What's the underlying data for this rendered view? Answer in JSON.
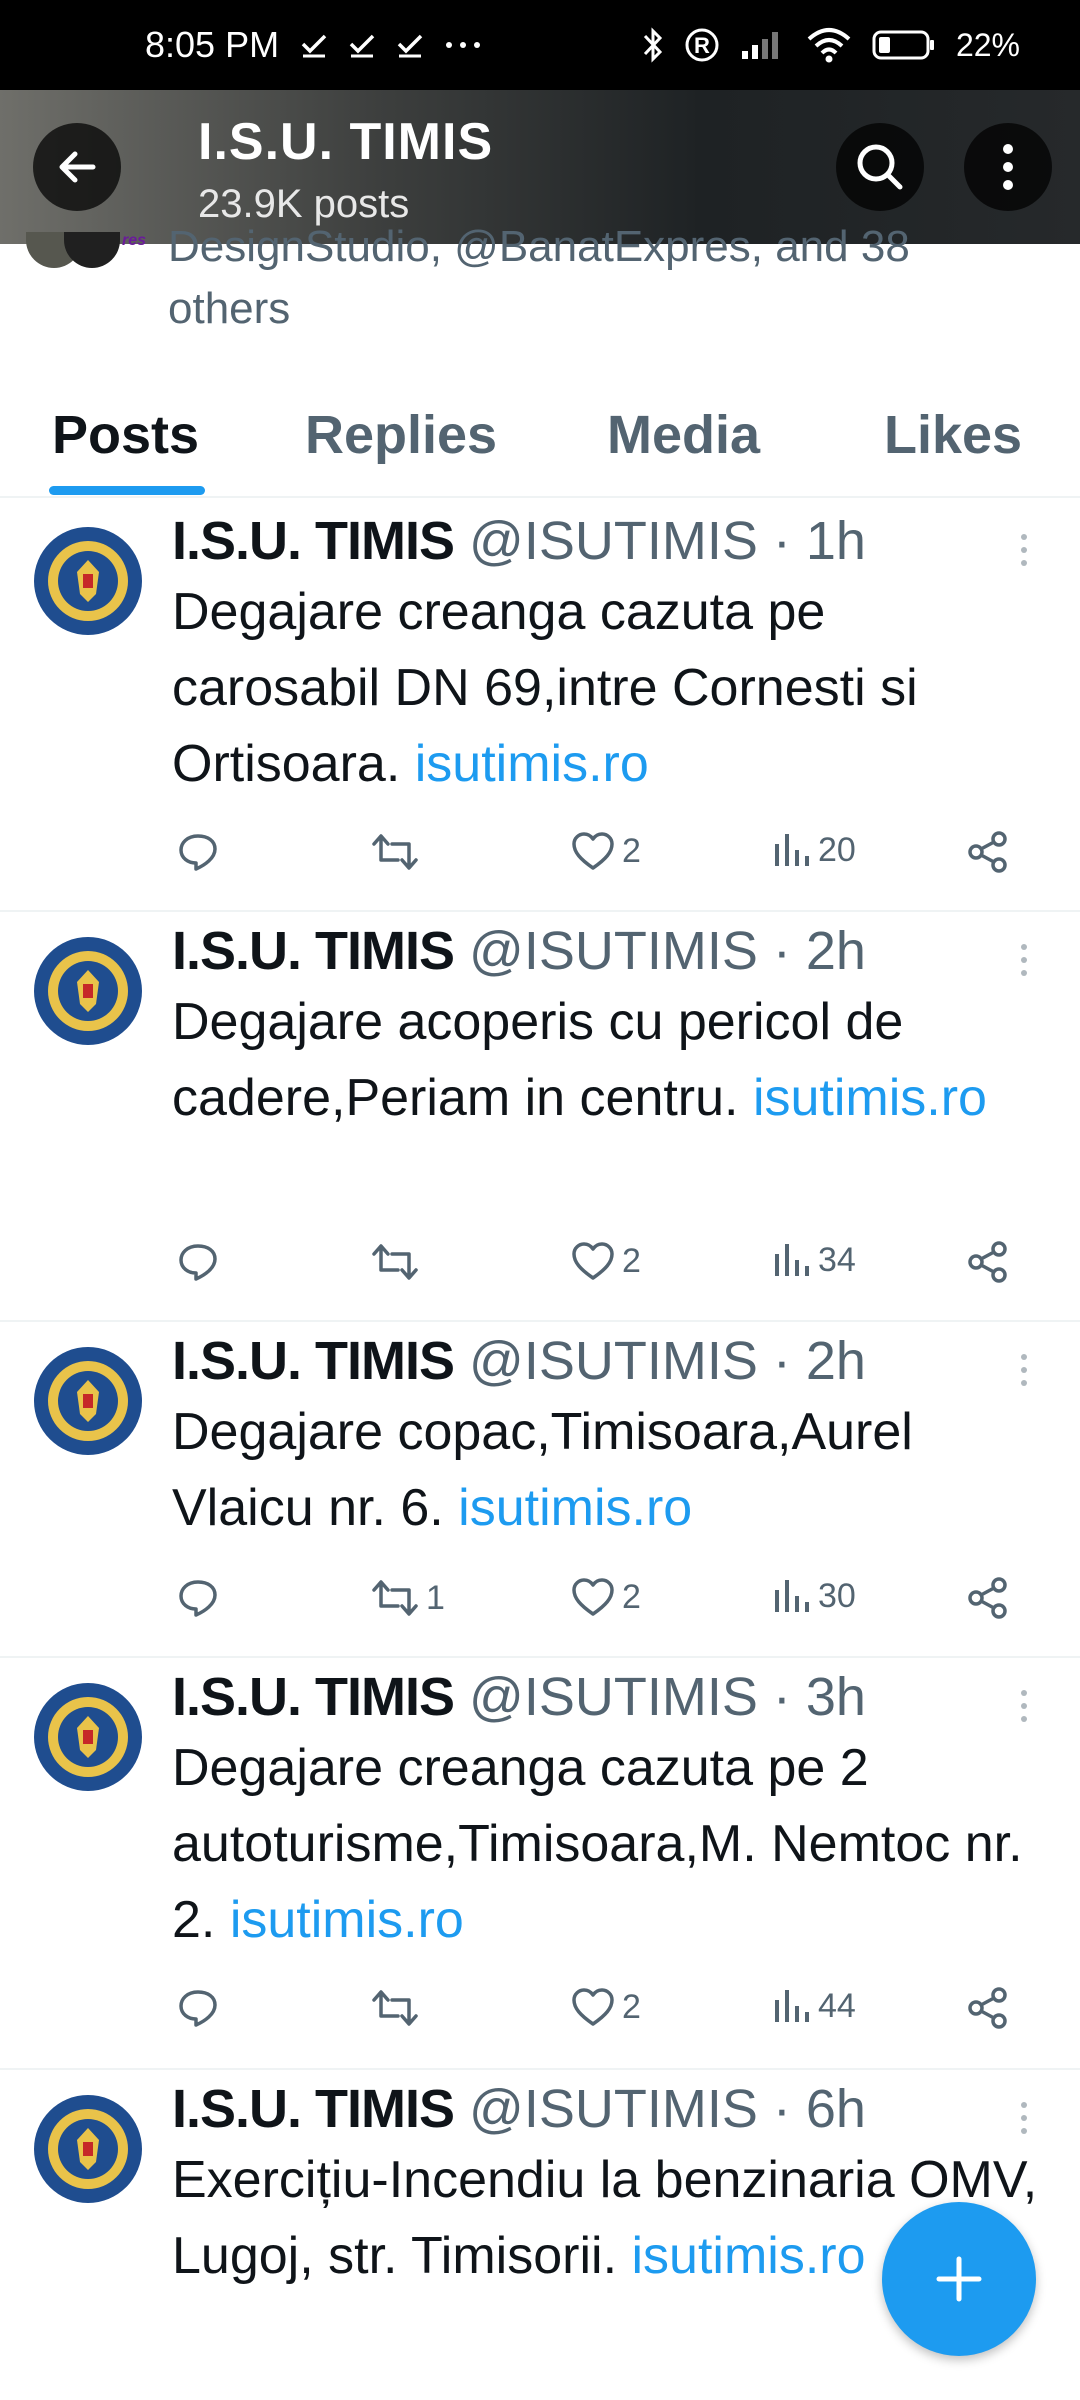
{
  "status_bar": {
    "time": "8:05 PM",
    "battery": "22%"
  },
  "header": {
    "title": "I.S.U. TIMIS",
    "subtitle": "23.9K posts"
  },
  "followers": {
    "line1": "DesignStudio, @BanatExpres, and 38",
    "line2": "others",
    "badge": "res"
  },
  "tabs": [
    {
      "label": "Posts",
      "active": true
    },
    {
      "label": "Replies",
      "active": false
    },
    {
      "label": "Media",
      "active": false
    },
    {
      "label": "Likes",
      "active": false
    }
  ],
  "posts": [
    {
      "name": "I.S.U. TIMIS",
      "handle": "@ISUTIMIS",
      "dot": "·",
      "time": "1h",
      "text": "Degajare creanga cazuta pe carosabil DN 69,intre Cornesti si Ortisoara.",
      "link": "isutimis.ro",
      "retweets": "",
      "likes": "2",
      "views": "20"
    },
    {
      "name": "I.S.U. TIMIS",
      "handle": "@ISUTIMIS",
      "dot": "·",
      "time": "2h",
      "text": "Degajare acoperis cu pericol de cadere,Periam in centru.",
      "link": "isutimis.ro",
      "retweets": "",
      "likes": "2",
      "views": "34"
    },
    {
      "name": "I.S.U. TIMIS",
      "handle": "@ISUTIMIS",
      "dot": "·",
      "time": "2h",
      "text": "Degajare copac,Timisoara,Aurel Vlaicu nr. 6.",
      "link": "isutimis.ro",
      "retweets": "1",
      "likes": "2",
      "views": "30"
    },
    {
      "name": "I.S.U. TIMIS",
      "handle": "@ISUTIMIS",
      "dot": "·",
      "time": "3h",
      "text": "Degajare creanga cazuta pe 2 autoturisme,Timisoara,M. Nemtoc nr. 2.",
      "link": "isutimis.ro",
      "retweets": "",
      "likes": "2",
      "views": "44"
    },
    {
      "name": "I.S.U. TIMIS",
      "handle": "@ISUTIMIS",
      "dot": "·",
      "time": "6h",
      "text": "Exercițiu-Incendiu la benzinaria OMV, Lugoj, str. Timisorii.",
      "link": "isutimis.ro"
    }
  ],
  "icons": {
    "back": "arrow-left-icon",
    "search": "search-icon",
    "more": "more-vertical-icon",
    "reply": "reply-icon",
    "retweet": "retweet-icon",
    "like": "heart-icon",
    "views": "views-icon",
    "share": "share-icon",
    "compose": "plus-icon"
  },
  "colors": {
    "accent": "#1d9bf0",
    "text": "#0f1419",
    "muted": "#536471"
  }
}
